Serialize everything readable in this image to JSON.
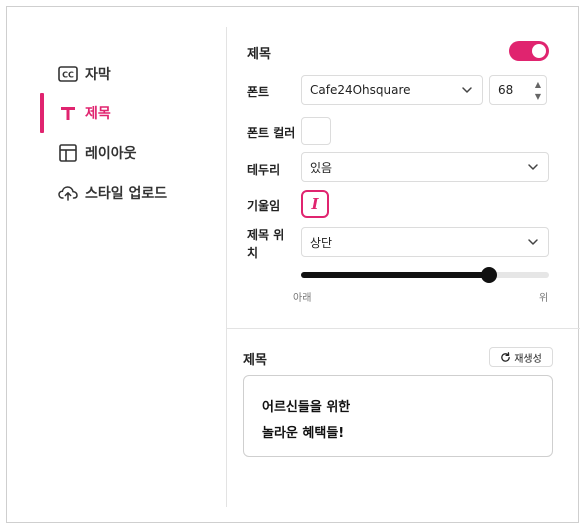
{
  "sidebar": {
    "items": [
      {
        "label": "자막",
        "icon": "cc-icon"
      },
      {
        "label": "제목",
        "icon": "title-t-icon",
        "active": true
      },
      {
        "label": "레이아웃",
        "icon": "layout-icon"
      },
      {
        "label": "스타일 업로드",
        "icon": "cloud-upload-icon"
      }
    ]
  },
  "title_settings": {
    "section_title": "제목",
    "enabled": true,
    "font_label": "폰트",
    "font_value": "Cafe24Ohsquare",
    "font_size": "68",
    "font_color_label": "폰트 컬러",
    "font_color": "#ffffff",
    "border_label": "테두리",
    "border_value": "있음",
    "italic_label": "기울임",
    "italic_on": true,
    "position_label_line1": "제목 위",
    "position_label_line2": "치",
    "position_value": "상단",
    "slider_min_label": "아래",
    "slider_max_label": "위",
    "slider_value": 0.76
  },
  "preview": {
    "title": "제목",
    "regenerate_label": "재생성",
    "lines": [
      "어르신들을 위한",
      "놀라운 혜택들!"
    ]
  },
  "colors": {
    "accent": "#e0246f"
  }
}
